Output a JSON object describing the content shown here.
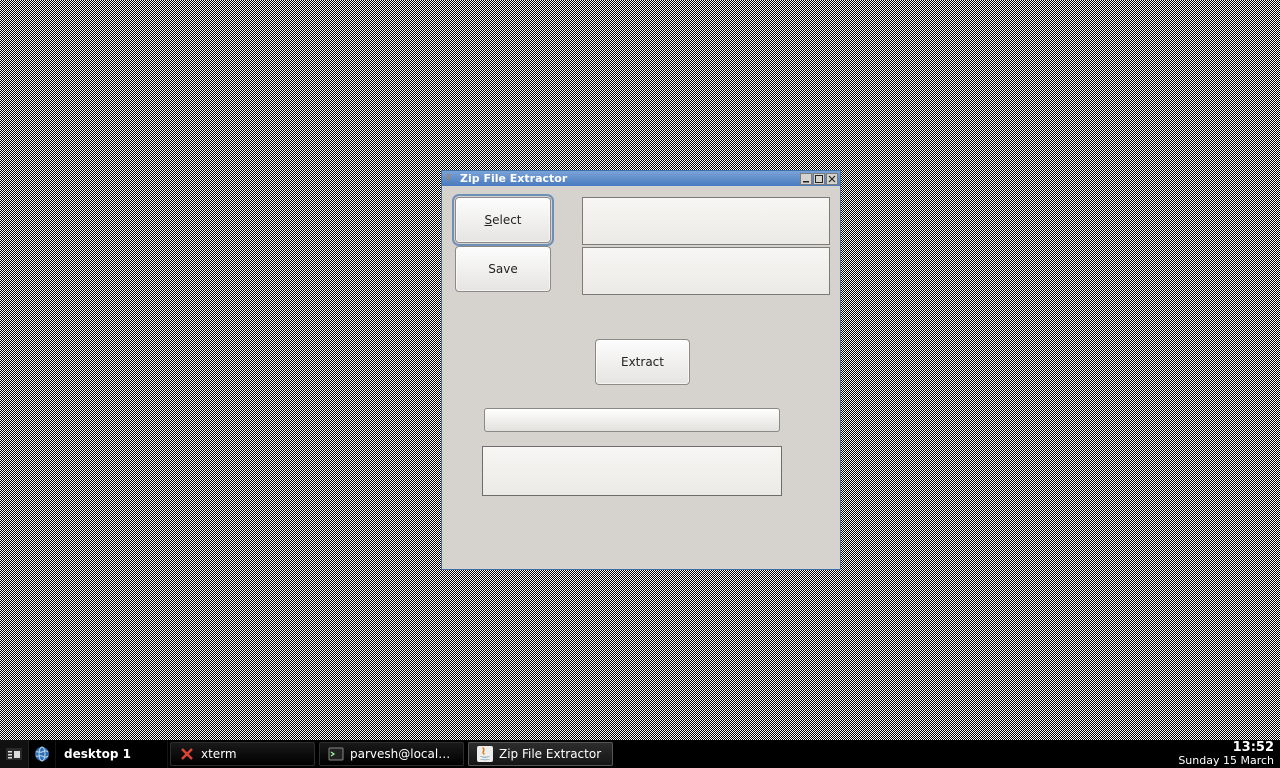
{
  "app": {
    "title": "Zip File Extractor",
    "buttons": {
      "select": "Select",
      "save": "Save",
      "extract": "Extract"
    },
    "fields": {
      "input_path": "",
      "output_path": "",
      "status": ""
    }
  },
  "taskbar": {
    "desktop_label": "desktop 1",
    "tasks": [
      {
        "label": "xterm",
        "icon": "xterm-icon",
        "active": false
      },
      {
        "label": "parvesh@localho...",
        "icon": "terminal-icon",
        "active": false
      },
      {
        "label": "Zip File Extractor",
        "icon": "java-icon",
        "active": true
      }
    ],
    "clock": {
      "time": "13:52",
      "date": "Sunday 15 March"
    }
  }
}
